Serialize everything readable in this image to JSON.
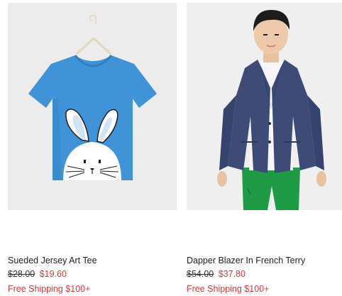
{
  "colors": {
    "sale": "#d63a3a",
    "shipping": "#d63a3a",
    "text": "#222222",
    "image_bg": "#ebebeb"
  },
  "products": [
    {
      "name": "Sueded Jersey Art Tee",
      "original_price": "$28.00",
      "sale_price": "$19.60",
      "shipping": "Free Shipping $100+",
      "image_subject": "blue-tee-with-bunny-print"
    },
    {
      "name": "Dapper Blazer In French Terry",
      "original_price": "$54.00",
      "sale_price": "$37.80",
      "shipping": "Free Shipping $100+",
      "image_subject": "boy-in-navy-blazer"
    }
  ]
}
